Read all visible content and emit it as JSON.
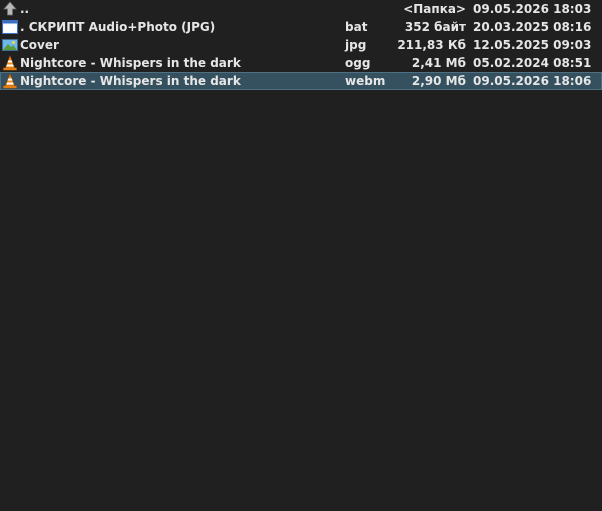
{
  "files": [
    {
      "icon": "up-arrow-icon",
      "name": "..",
      "ext": "",
      "size": "<Папка>",
      "date": "09.05.2026 18:03",
      "selected": false
    },
    {
      "icon": "script-window-icon",
      "name": ". СКРИПТ Audio+Photo (JPG)",
      "ext": "bat",
      "size": "352 байт",
      "date": "20.03.2025 08:16",
      "selected": false
    },
    {
      "icon": "image-file-icon",
      "name": "Cover",
      "ext": "jpg",
      "size": "211,83 Кб",
      "date": "12.05.2025 09:03",
      "selected": false
    },
    {
      "icon": "vlc-cone-icon",
      "name": "Nightcore - Whispers in the dark",
      "ext": "ogg",
      "size": "2,41 Мб",
      "date": "05.02.2024 08:51",
      "selected": false
    },
    {
      "icon": "vlc-cone-icon",
      "name": "Nightcore - Whispers in the dark",
      "ext": "webm",
      "size": "2,90 Мб",
      "date": "09.05.2026 18:06",
      "selected": true
    }
  ],
  "colors": {
    "background": "#202020",
    "text": "#e6e6e6",
    "selection": "#35505f"
  }
}
